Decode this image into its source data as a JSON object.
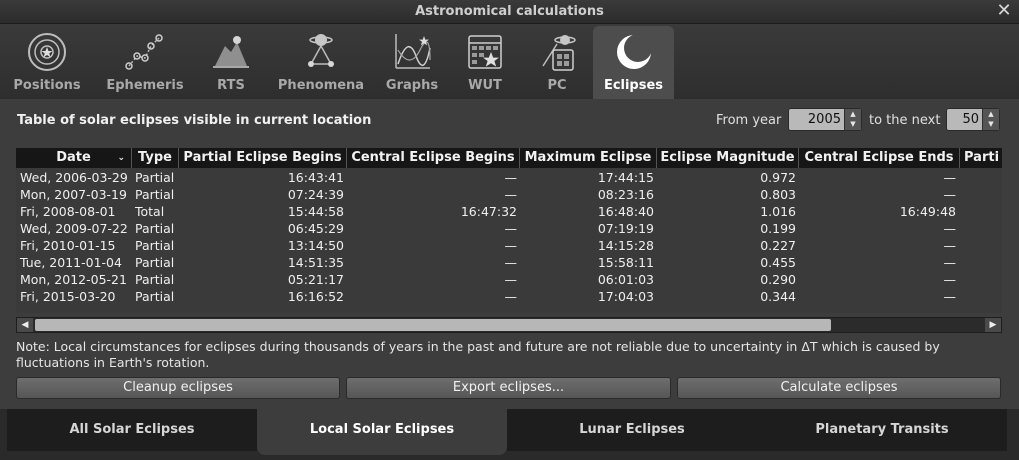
{
  "window": {
    "title": "Astronomical calculations",
    "close_glyph": "✕"
  },
  "toolbar": [
    {
      "label": "Positions",
      "icon": "positions-icon"
    },
    {
      "label": "Ephemeris",
      "icon": "ephemeris-icon"
    },
    {
      "label": "RTS",
      "icon": "rts-icon"
    },
    {
      "label": "Phenomena",
      "icon": "phenomena-icon"
    },
    {
      "label": "Graphs",
      "icon": "graphs-icon"
    },
    {
      "label": "WUT",
      "icon": "wut-icon"
    },
    {
      "label": "PC",
      "icon": "pc-icon"
    },
    {
      "label": "Eclipses",
      "icon": "eclipses-icon",
      "active": true
    }
  ],
  "main": {
    "table_title": "Table of solar eclipses visible in current location",
    "from_year_label": "From year",
    "from_year_value": "2005",
    "to_next_label": "to the next",
    "to_next_value": "50",
    "columns": [
      "Date",
      "Type",
      "Partial Eclipse Begins",
      "Central Eclipse Begins",
      "Maximum Eclipse",
      "Eclipse Magnitude",
      "Central Eclipse Ends",
      "Parti"
    ],
    "rows": [
      [
        "Wed, 2006-03-29",
        "Partial",
        "16:43:41",
        "—",
        "17:44:15",
        "0.972",
        "—"
      ],
      [
        "Mon, 2007-03-19",
        "Partial",
        "07:24:39",
        "—",
        "08:23:16",
        "0.803",
        "—"
      ],
      [
        "Fri, 2008-08-01",
        "Total",
        "15:44:58",
        "16:47:32",
        "16:48:40",
        "1.016",
        "16:49:48"
      ],
      [
        "Wed, 2009-07-22",
        "Partial",
        "06:45:29",
        "—",
        "07:19:19",
        "0.199",
        "—"
      ],
      [
        "Fri, 2010-01-15",
        "Partial",
        "13:14:50",
        "—",
        "14:15:28",
        "0.227",
        "—"
      ],
      [
        "Tue, 2011-01-04",
        "Partial",
        "14:51:35",
        "—",
        "15:58:11",
        "0.455",
        "—"
      ],
      [
        "Mon, 2012-05-21",
        "Partial",
        "05:21:17",
        "—",
        "06:01:03",
        "0.290",
        "—"
      ],
      [
        "Fri, 2015-03-20",
        "Partial",
        "16:16:52",
        "—",
        "17:04:03",
        "0.344",
        "—"
      ]
    ],
    "note": "Note: Local circumstances for eclipses during thousands of years in the past and future are not reliable due to uncertainty in ΔT which is caused by fluctuations in Earth's rotation.",
    "buttons": {
      "cleanup": "Cleanup eclipses",
      "export": "Export eclipses...",
      "calculate": "Calculate eclipses"
    }
  },
  "bottom_tabs": [
    {
      "label": "All Solar Eclipses"
    },
    {
      "label": "Local Solar Eclipses",
      "active": true
    },
    {
      "label": "Lunar Eclipses"
    },
    {
      "label": "Planetary Transits"
    }
  ],
  "colors": {
    "accent": "#ffffff",
    "header_bg": "#161616",
    "panel_bg": "#3d3d3d"
  }
}
